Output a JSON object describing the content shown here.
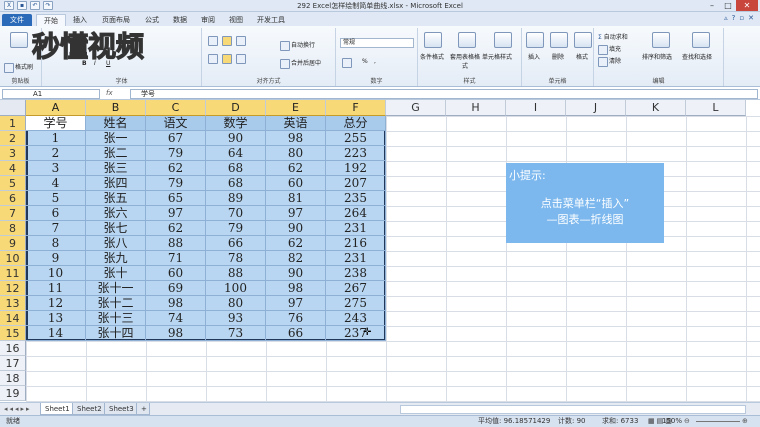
{
  "window": {
    "title": "292 Excel怎样绘制简单曲线.xlsx - Microsoft Excel",
    "controls": [
      "–",
      "□",
      "✕"
    ]
  },
  "ribbon_tabs": [
    "文件",
    "开始",
    "插入",
    "页面布局",
    "公式",
    "数据",
    "审阅",
    "视图",
    "开发工具"
  ],
  "ribbon": {
    "clipboard": {
      "format_painter": "格式刷",
      "label": "剪贴板"
    },
    "font": {
      "label": "字体"
    },
    "alignment": {
      "wrap_text": "自动换行",
      "merge_center": "合并后居中",
      "label": "对齐方式"
    },
    "number": {
      "format": "常规",
      "percent": "%",
      "comma": ",",
      "label": "数字"
    },
    "styles": {
      "conditional": "条件格式",
      "table_format": "套用表格格式",
      "cell_styles": "单元格样式",
      "label": "样式"
    },
    "cells": {
      "insert": "插入",
      "delete": "删除",
      "format": "格式",
      "label": "单元格"
    },
    "editing": {
      "autosum": "自动求和",
      "fill": "填充",
      "clear": "清除",
      "sort_filter": "排序和筛选",
      "find_select": "查找和选择",
      "label": "编辑"
    }
  },
  "logo_text": "秒懂视频",
  "formula_bar": {
    "name_box": "A1",
    "fx": "fx",
    "content": "学号"
  },
  "columns": [
    "A",
    "B",
    "C",
    "D",
    "E",
    "F",
    "G",
    "H",
    "I",
    "J",
    "K",
    "L"
  ],
  "rows": [
    "1",
    "2",
    "3",
    "4",
    "5",
    "6",
    "7",
    "8",
    "9",
    "10",
    "11",
    "12",
    "13",
    "14",
    "15",
    "16",
    "17",
    "18",
    "19"
  ],
  "table": {
    "headers": [
      "学号",
      "姓名",
      "语文",
      "数学",
      "英语",
      "总分"
    ],
    "data": [
      [
        "1",
        "张一",
        "67",
        "90",
        "98",
        "255"
      ],
      [
        "2",
        "张二",
        "79",
        "64",
        "80",
        "223"
      ],
      [
        "3",
        "张三",
        "62",
        "68",
        "62",
        "192"
      ],
      [
        "4",
        "张四",
        "79",
        "68",
        "60",
        "207"
      ],
      [
        "5",
        "张五",
        "65",
        "89",
        "81",
        "235"
      ],
      [
        "6",
        "张六",
        "97",
        "70",
        "97",
        "264"
      ],
      [
        "7",
        "张七",
        "62",
        "79",
        "90",
        "231"
      ],
      [
        "8",
        "张八",
        "88",
        "66",
        "62",
        "216"
      ],
      [
        "9",
        "张九",
        "71",
        "78",
        "82",
        "231"
      ],
      [
        "10",
        "张十",
        "60",
        "88",
        "90",
        "238"
      ],
      [
        "11",
        "张十一",
        "69",
        "100",
        "98",
        "267"
      ],
      [
        "12",
        "张十二",
        "98",
        "80",
        "97",
        "275"
      ],
      [
        "13",
        "张十三",
        "74",
        "93",
        "76",
        "243"
      ],
      [
        "14",
        "张十四",
        "98",
        "73",
        "66",
        "237"
      ]
    ]
  },
  "tip": {
    "title": "小提示:",
    "line1": "点击菜单栏“插入”",
    "line2": "—图表—折线图"
  },
  "sheets": [
    "Sheet1",
    "Sheet2",
    "Sheet3"
  ],
  "status": {
    "ready": "就绪",
    "average": "平均值: 96.18571429",
    "count": "计数: 90",
    "sum": "求和: 6733",
    "zoom": "150%"
  }
}
